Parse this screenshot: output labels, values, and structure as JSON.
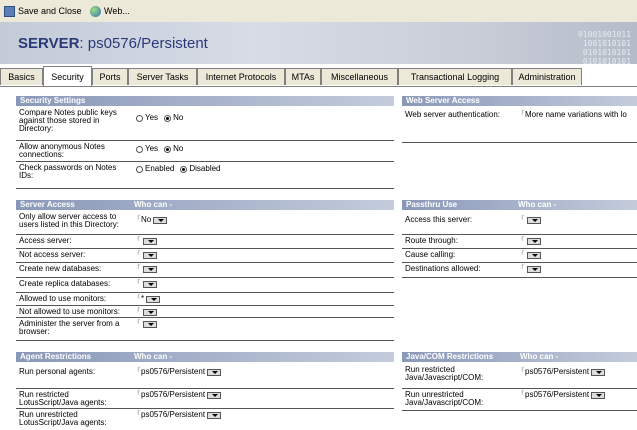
{
  "toolbar": {
    "save_close": "Save and Close",
    "web": "Web...",
    "save_icon": "save-close-icon",
    "web_icon": "web-globe-icon"
  },
  "banner": {
    "title": "SERVER",
    "subtitle": ": ps0576/Persistent",
    "digits_1": "01001001011",
    "digits_2": "1001010101",
    "digits_3": "0101010101",
    "digits_4": "0101010101"
  },
  "tabs": [
    "Basics",
    "Security",
    "Ports",
    "Server Tasks",
    "Internet Protocols",
    "MTAs",
    "Miscellaneous",
    "Transactional Logging",
    "Administration"
  ],
  "active_tab": "Security",
  "security_settings": {
    "header": "Security Settings",
    "compare_label": "Compare Notes public keys against those stored in Directory:",
    "compare_yes": "Yes",
    "compare_no": "No",
    "compare_selected": "No",
    "anon_label": "Allow anonymous Notes connections:",
    "anon_yes": "Yes",
    "anon_no": "No",
    "anon_selected": "No",
    "check_label": "Check passwords on Notes IDs:",
    "check_enabled": "Enabled",
    "check_disabled": "Disabled",
    "check_selected": "Disabled"
  },
  "web_server_access": {
    "header": "Web Server Access",
    "auth_label": "Web server authentication:",
    "auth_value": "More name variations with lo"
  },
  "server_access": {
    "header": "Server Access",
    "who_can": "Who can -",
    "only_allow_label": "Only allow server access to users listed in this Directory:",
    "only_allow_value": "No",
    "access_server": "Access server:",
    "not_access_server": "Not access server:",
    "create_db": "Create new databases:",
    "create_replica": "Create replica databases:",
    "allowed_monitors": "Allowed to use monitors:",
    "allowed_monitors_value": "*",
    "not_allowed_monitors": "Not allowed to use monitors:",
    "administer": "Administer the server from a browser:"
  },
  "passthru": {
    "header": "Passthru Use",
    "who_can": "Who can -",
    "access": "Access this server:",
    "route": "Route through:",
    "cause": "Cause calling:",
    "destinations": "Destinations allowed:"
  },
  "agent_restrictions": {
    "header": "Agent Restrictions",
    "who_can": "Who can -",
    "personal_label": "Run personal agents:",
    "personal_value": "ps0576/Persistent",
    "restricted_label": "Run restricted LotusScript/Java agents:",
    "restricted_value": "ps0576/Persistent",
    "unrestricted_label": "Run unrestricted LotusScript/Java agents:",
    "unrestricted_value": "ps0576/Persistent"
  },
  "java_com": {
    "header": "Java/COM Restrictions",
    "who_can": "Who can -",
    "restricted_label": "Run restricted Java/Javascript/COM:",
    "restricted_value": "ps0576/Persistent",
    "unrestricted_label": "Run unrestricted Java/Javascript/COM:",
    "unrestricted_value": "ps0576/Persistent"
  },
  "colors": {
    "section_header": "#8a98b8",
    "banner_title": "#2a3a78",
    "toolbar_bg": "#ece9d8"
  }
}
